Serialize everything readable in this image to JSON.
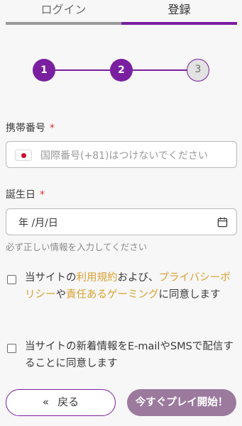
{
  "tabs": {
    "login": "ログイン",
    "register": "登録"
  },
  "stepper": {
    "step1": "1",
    "step2": "2",
    "step3": "3"
  },
  "phone": {
    "label": "携帯番号",
    "required_mark": "*",
    "placeholder": "国際番号(+81)はつけないでください",
    "flag_icon": "japan-flag-icon"
  },
  "birthday": {
    "label": "誕生日",
    "required_mark": "*",
    "value": "年 /月/日",
    "hint": "必ず正しい情報を入力してください"
  },
  "terms": {
    "prefix": "当サイトの",
    "link1": "利用規約",
    "middle1": "および、",
    "link2": "プライバシーポリシー",
    "middle2": "や",
    "link3": "責任あるゲーミング",
    "suffix": "に同意します"
  },
  "newsletter": {
    "text": "当サイトの新着情報をE-mailやSMSで配信することに同意します"
  },
  "buttons": {
    "back_chevron": "«",
    "back": "戻る",
    "start": "今すぐプレイ開始！"
  },
  "colors": {
    "accent": "#7a1fa0",
    "link": "#d9a233",
    "required": "#e0303a",
    "start_button": "#9b7a9e"
  }
}
